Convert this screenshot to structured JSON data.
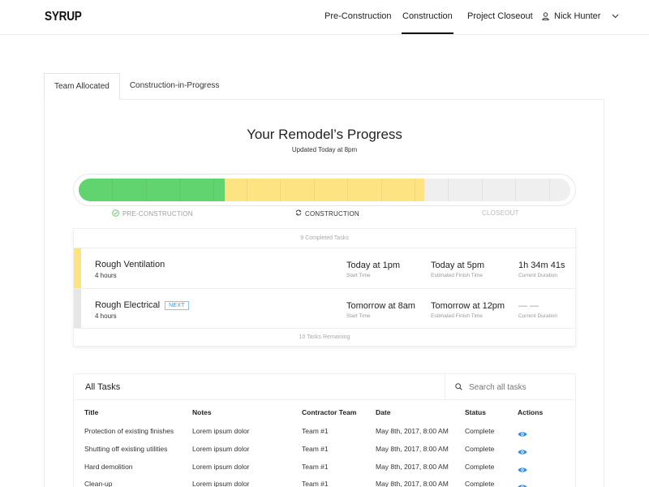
{
  "header": {
    "logo": "SYRUP",
    "nav": [
      "Pre-Construction",
      "Construction",
      "Project Closeout"
    ],
    "active_nav": "Construction",
    "user_name": "Nick Hunter"
  },
  "tabs": [
    "Team Allocated",
    "Construction-in-Progress"
  ],
  "progress": {
    "title": "Your Remodel’s Progress",
    "subtitle": "Updated Today at 8pm",
    "phases": [
      "PRE-CONSTRUCTION",
      "CONSTRUCTION",
      "CLOSEOUT"
    ],
    "phase_fractions": {
      "pre_construction": 0.297,
      "construction": 0.406,
      "closeout": 0.297
    },
    "colors": {
      "done": "#62d46f",
      "current": "#fde382",
      "pending": "#efefef"
    }
  },
  "tasks": {
    "completed_note": "9 Completed Tasks",
    "remaining_note": "10 Tasks Remaining",
    "rows": [
      {
        "name": "Rough Ventilation",
        "duration": "4 hours",
        "start": "Today at 1pm",
        "start_label": "Start Time",
        "finish": "Today at 5pm",
        "finish_label": "Estimated Finish Time",
        "current": "1h 34m 41s",
        "current_label": "Current Duration",
        "accent": "#fde382"
      },
      {
        "name": "Rough Electrical",
        "badge": "NEXT",
        "duration": "4 hours",
        "start": "Tomorrow at 8am",
        "start_label": "Start Time",
        "finish": "Tomorrow at 12pm",
        "finish_label": "Estimated Finish Time",
        "current": "— —",
        "current_label": "Current Duration",
        "accent": "#e6e6e6"
      }
    ]
  },
  "all_tasks": {
    "title": "All Tasks",
    "search_placeholder": "Search all tasks",
    "columns": [
      "Title",
      "Notes",
      "Contractor Team",
      "Date",
      "Status",
      "Actions"
    ],
    "rows": [
      [
        "Protection of existing finishes",
        "Lorem ipsum dolor",
        "Team #1",
        "May 8th, 2017, 8:00 AM",
        "Complete"
      ],
      [
        "Shutting off existing utilities",
        "Lorem ipsum dolor",
        "Team #1",
        "May 8th, 2017, 8:00 AM",
        "Complete"
      ],
      [
        "Hard demolition",
        "Lorem ipsum dolor",
        "Team #1",
        "May 8th, 2017, 8:00 AM",
        "Complete"
      ],
      [
        "Clean-up",
        "Lorem ipsum dolor",
        "Team #1",
        "May 8th, 2017, 8:00 AM",
        "Complete"
      ]
    ],
    "action_icon": "eye-icon",
    "action_color": "#2f8de4"
  }
}
